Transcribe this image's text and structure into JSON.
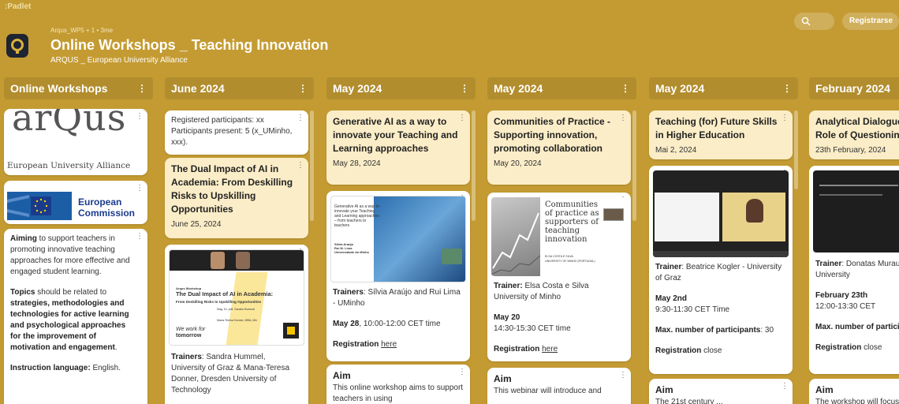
{
  "app": {
    "brand": ":Padlet",
    "meta": "Arqus_WP5 + 1 • 3me",
    "title": "Online Workshops _ Teaching Innovation",
    "subtitle": "ARQUS _ European University Alliance",
    "register": "Registrarse"
  },
  "columns": [
    {
      "header": "Online Workshops",
      "cards": [
        {
          "logo_word": "arQus",
          "logo_caption": "European University Alliance"
        },
        {
          "ec_line1": "European",
          "ec_line2": "Commission"
        },
        {
          "aim_b": "Aiming",
          "aim_t": " to support teachers in promoting innovative teaching approaches for more effective and engaged student learning.",
          "topics_b": "Topics",
          "topics_t": " should be related to ",
          "topics_b2": "strategies, methodologies and technologies for active learning and psychological approaches for the improvement of motivation and engagement",
          "topics_end": ".",
          "lang_b": "Instruction language:",
          "lang_t": " English."
        }
      ]
    },
    {
      "header": "June 2024",
      "cards": [
        {
          "l1": "Registered participants: xx",
          "l2": "Participants present: 5 (x_UMinho, xxx)."
        },
        {
          "title": "The Dual Impact of AI in Academia: From Deskilling Risks to Upskilling Opportunities",
          "date": "June 25, 2024"
        },
        {
          "thumb_kicker": "Arqus Workshop",
          "thumb_title": "The Dual Impact of AI in Academia:",
          "thumb_sub": "From Deskilling Risks to Upskilling Opportunities",
          "thumb_names": "Mag. Dr. phil. Sandra Hummel\nMana-Teresa Donner, MBA, MA",
          "thumb_tag1": "We work for",
          "thumb_tag2": "tomorrow",
          "trainers_b": "Trainers",
          "trainers_t": ": Sandra Hummel, University of Graz & Mana-Teresa Donner, Dresden University of Technology"
        }
      ]
    },
    {
      "header": "May 2024",
      "cards": [
        {
          "title": "Generative AI as a way to innovate your Teaching and Learning approaches",
          "date": "May 28, 2024"
        },
        {
          "thumb_title": "Generative AI as a way to innovate your Teaching and Learning approaches – from teachers to teachers",
          "thumb_names": "Sílvia Araújo\nRui M. Lima\nUniversidade do Minho",
          "trainers_b": "Trainers",
          "trainers_t": ": Sílvia Araújo and Rui Lima - UMinho",
          "date_b": "May 28",
          "date_t": ", 10:00-12:00 CET time",
          "reg_b": "Registration",
          "reg_link": "here"
        },
        {
          "aim": "Aim",
          "text": "This online workshop aims to support teachers in using"
        }
      ]
    },
    {
      "header": "May 2024",
      "cards": [
        {
          "title": "Communities of Practice - Supporting innovation, promoting collaboration",
          "date": "May 20, 2024"
        },
        {
          "thumb_title": "Communities of practice as supporters of teaching innovation",
          "thumb_author": "ELSA COSTA E SILVA",
          "thumb_uni": "UNIVERSITY OF MINHO (PORTUGAL)",
          "trainer_b": "Trainer:",
          "trainer_t": " Elsa Costa e Silva University of Minho",
          "date_b": "May 20",
          "time": "14:30-15:30 CET time",
          "reg_b": "Registration",
          "reg_link": "here"
        },
        {
          "aim": "Aim",
          "text": "This webinar will introduce and"
        }
      ]
    },
    {
      "header": "May 2024",
      "cards": [
        {
          "title": "Teaching (for) Future Skills in Higher Education",
          "date": "Mai 2, 2024"
        },
        {
          "trainer_b": "Trainer",
          "trainer_t": ": Beatrice Kogler - University of Graz",
          "date_b": "May 2nd",
          "time": "9:30-11:30 CET Time",
          "max_b": "Max. number of participants",
          "max_t": ": 30",
          "reg_b": "Registration",
          "reg_t": " close"
        },
        {
          "aim": "Aim",
          "text": "The 21st century ..."
        }
      ]
    },
    {
      "header": "February 2024",
      "cards": [
        {
          "title": "Analytical Dialogue: The Role of Questioning",
          "date": "23th February, 2024"
        },
        {
          "trainer_b": "Trainer",
          "trainer_t": ": Donatas Murauskas Vilnius University",
          "date_b": "February 23th",
          "time": "12:00-13:30 CET",
          "max_b": "Max. number of participants",
          "reg_b": "Registration",
          "reg_t": " close"
        },
        {
          "aim": "Aim",
          "text": "The workshop will focus on"
        }
      ]
    }
  ],
  "colors": {
    "background": "#c49b32",
    "card": "#ffffff",
    "card_highlight": "#fbedc7"
  },
  "icons": [
    "search-icon",
    "more-icon",
    "logo-icon",
    "eu-flag-icon"
  ]
}
